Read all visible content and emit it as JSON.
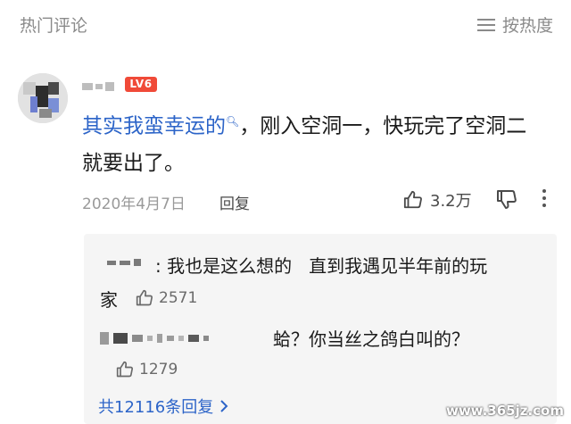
{
  "header": {
    "title": "热门评论",
    "sort_label": "按热度",
    "sort_icon": "sort-lines-icon"
  },
  "comment": {
    "level_badge": "LV6",
    "topic_tag": "其实我蛮幸运的",
    "text": "，刚入空洞一，快玩完了空洞二",
    "text_line2": "就要出了。",
    "date": "2020年4月7日",
    "reply_label": "回复",
    "likes": "3.2万"
  },
  "replies": [
    {
      "text": ": 我也是这么想的   直到我遇见半年前的玩",
      "text_line2": "家",
      "likes": "2571"
    },
    {
      "text": "蛤？你当丝之鸽白叫的？",
      "likes": "1279"
    }
  ],
  "replies_total": "共12116条回复",
  "watermark": "www.365jz.com",
  "colors": {
    "accent": "#2c64c8",
    "badge": "#f04a38"
  }
}
